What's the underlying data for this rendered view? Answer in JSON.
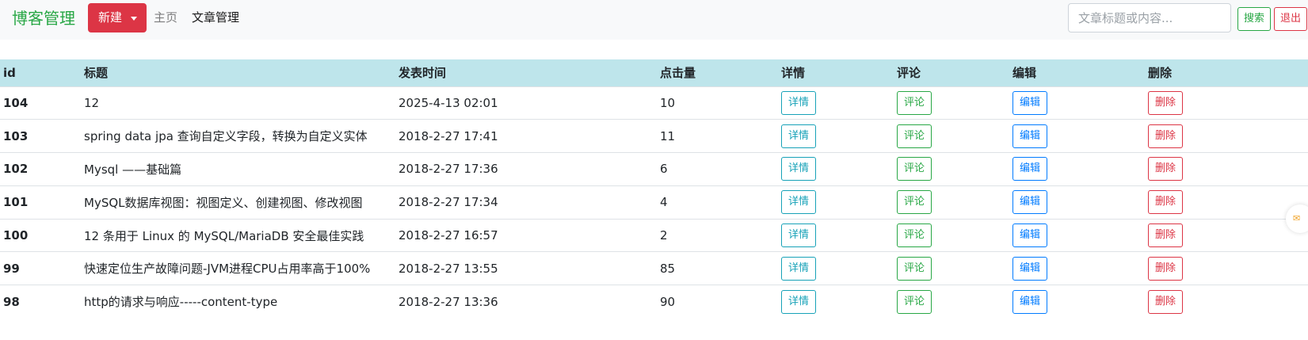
{
  "navbar": {
    "brand": "博客管理",
    "new_label": "新建",
    "links": [
      "主页",
      "文章管理"
    ],
    "search_placeholder": "文章标题或内容...",
    "search_label": "搜索",
    "logout_label": "退出"
  },
  "table": {
    "headers": [
      "id",
      "标题",
      "发表时间",
      "点击量",
      "详情",
      "评论",
      "编辑",
      "删除"
    ],
    "actions": [
      "详情",
      "评论",
      "编辑",
      "删除"
    ],
    "rows": [
      {
        "id": "104",
        "title": "12",
        "time": "2025-4-13 02:01",
        "clicks": "10"
      },
      {
        "id": "103",
        "title": "spring data jpa 查询自定义字段，转换为自定义实体",
        "time": "2018-2-27 17:41",
        "clicks": "11"
      },
      {
        "id": "102",
        "title": "Mysql ——基础篇",
        "time": "2018-2-27 17:36",
        "clicks": "6"
      },
      {
        "id": "101",
        "title": "MySQL数据库视图：视图定义、创建视图、修改视图",
        "time": "2018-2-27 17:34",
        "clicks": "4"
      },
      {
        "id": "100",
        "title": "12 条用于 Linux 的 MySQL/MariaDB 安全最佳实践",
        "time": "2018-2-27 16:57",
        "clicks": "2"
      },
      {
        "id": "99",
        "title": "快速定位生产故障问题-JVM进程CPU占用率高于100%",
        "time": "2018-2-27 13:55",
        "clicks": "85"
      },
      {
        "id": "98",
        "title": "http的请求与响应-----content-type",
        "time": "2018-2-27 13:36",
        "clicks": "90"
      }
    ]
  },
  "colors": {
    "brand": "#28a745",
    "header_bg": "#bee5eb",
    "danger": "#dc3545",
    "info": "#17a2b8",
    "primary": "#007bff"
  },
  "icons": {
    "new_dropdown": "caret-down-icon",
    "floating_widget": "message-icon"
  }
}
